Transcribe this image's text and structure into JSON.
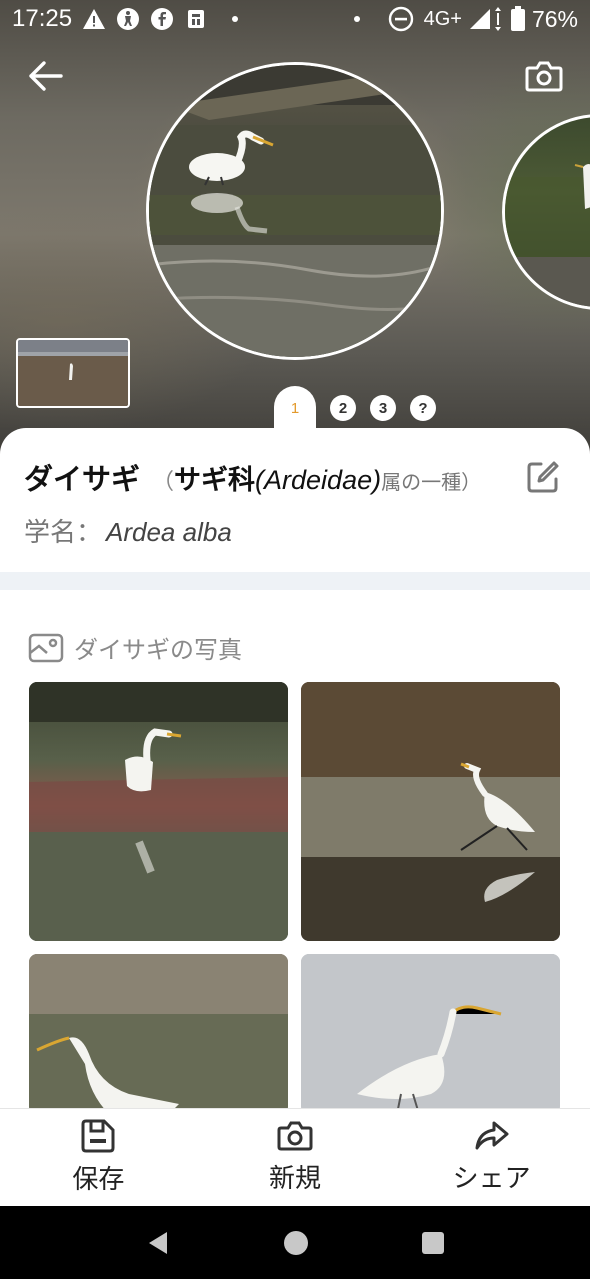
{
  "status_bar": {
    "time": "17:25",
    "network": "4G+",
    "battery": "76%",
    "icons": [
      "warning-icon",
      "accessibility-icon",
      "facebook-icon",
      "clipboard-icon",
      "dnd-icon",
      "signal-icon",
      "battery-icon"
    ]
  },
  "header": {
    "back_icon": "arrow-left-icon",
    "camera_icon": "camera-icon"
  },
  "pager": {
    "tabs": [
      "1",
      "2",
      "3",
      "?"
    ],
    "active_index": 0,
    "active_color": "#e39a2c"
  },
  "species": {
    "name": "ダイサギ",
    "paren_open": "（",
    "family_ja": "サギ科",
    "family_sci": "(Ardeidae)",
    "genus_note": "属の一種）",
    "sci_label": "学名：",
    "sci_name": "Ardea alba"
  },
  "photos": {
    "title": "ダイサギの写真",
    "icon": "image-icon"
  },
  "actions": [
    {
      "label": "保存",
      "icon": "save-icon"
    },
    {
      "label": "新規",
      "icon": "camera-icon"
    },
    {
      "label": "シェア",
      "icon": "share-icon"
    }
  ],
  "colors": {
    "accent": "#e39a2c",
    "divider": "#eef2f6",
    "text_primary": "#111111",
    "text_secondary": "#777777"
  }
}
